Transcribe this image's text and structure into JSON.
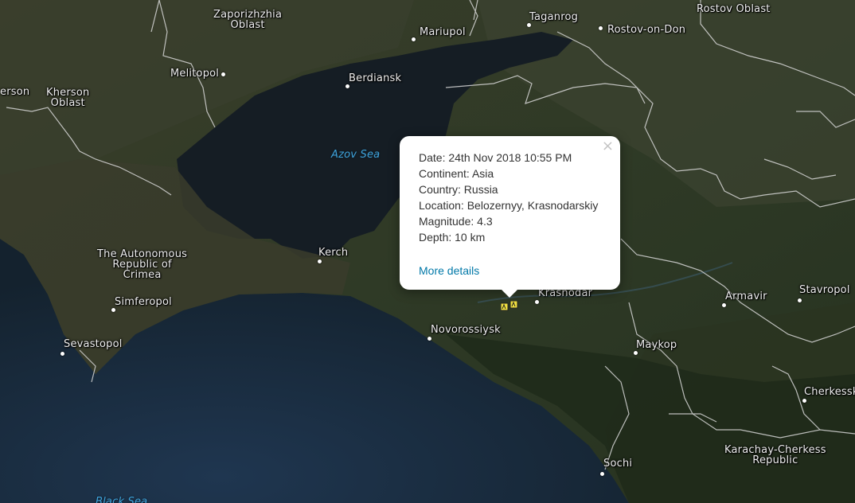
{
  "popup": {
    "close_glyph": "×",
    "date": "Date: 24th Nov 2018 10:55 PM",
    "continent": "Continent: Asia",
    "country": "Country: Russia",
    "location": "Location: Belozernyy, Krasnodarskiy",
    "magnitude": "Magnitude: 4.3",
    "depth": "Depth: 10 km",
    "more_details": "More details"
  },
  "labels": {
    "zaporizhzhia_1": "Zaporizhzhia",
    "zaporizhzhia_2": "Oblast",
    "taganrog": "Taganrog",
    "rostov_oblast": "Rostov Oblast",
    "mariupol": "Mariupol",
    "rostov_on_don": "Rostov-on-Don",
    "kherson_city": "erson",
    "kherson_oblast_1": "Kherson",
    "kherson_oblast_2": "Oblast",
    "melitopol": "Melitopol",
    "berdiansk": "Berdiansk",
    "azov_sea": "Azov Sea",
    "crimea_1": "The Autonomous",
    "crimea_2": "Republic of",
    "crimea_3": "Crimea",
    "kerch": "Kerch",
    "simferopol": "Simferopol",
    "sevastopol": "Sevastopol",
    "novorossiysk": "Novorossiysk",
    "krasnodar": "Krasnodar",
    "armavir": "Armavir",
    "stavropol": "Stavropol",
    "maykop": "Maykop",
    "cherkessk": "Cherkessk",
    "karachay_1": "Karachay-Cherkess",
    "karachay_2": "Republic",
    "sochi": "Sochi",
    "black_sea": "Black Sea"
  },
  "colors": {
    "land_dark": "#2a3022",
    "sea": "#16202a",
    "black_sea": "#1a2a3c",
    "border": "#d8d8d8",
    "link": "#0078a8",
    "marker": "#f0e040"
  },
  "marker": {
    "icon": "earthquake-marker-icon"
  }
}
